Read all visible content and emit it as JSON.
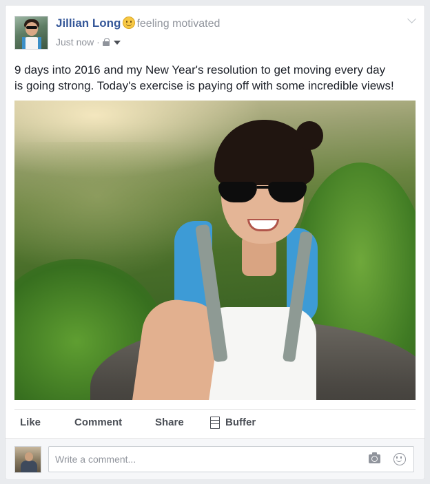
{
  "post": {
    "author_name": "Jillian Long",
    "feeling_text": "feeling motivated",
    "feeling_icon": "smiley-icon",
    "timestamp": "Just now",
    "separator": "·",
    "privacy_icon": "lock-icon",
    "text_lines": [
      "9 days into 2016 and my New Year's resolution to get moving every day",
      "is going strong. Today's exercise is paying off with some incredible views!"
    ]
  },
  "actions": {
    "like_label": "Like",
    "comment_label": "Comment",
    "share_label": "Share",
    "buffer_label": "Buffer"
  },
  "comment": {
    "placeholder": "Write a comment..."
  },
  "colors": {
    "name_link": "#365899",
    "secondary_text": "#90949c",
    "action_text": "#4b4f56",
    "page_bg": "#e9ebee"
  }
}
